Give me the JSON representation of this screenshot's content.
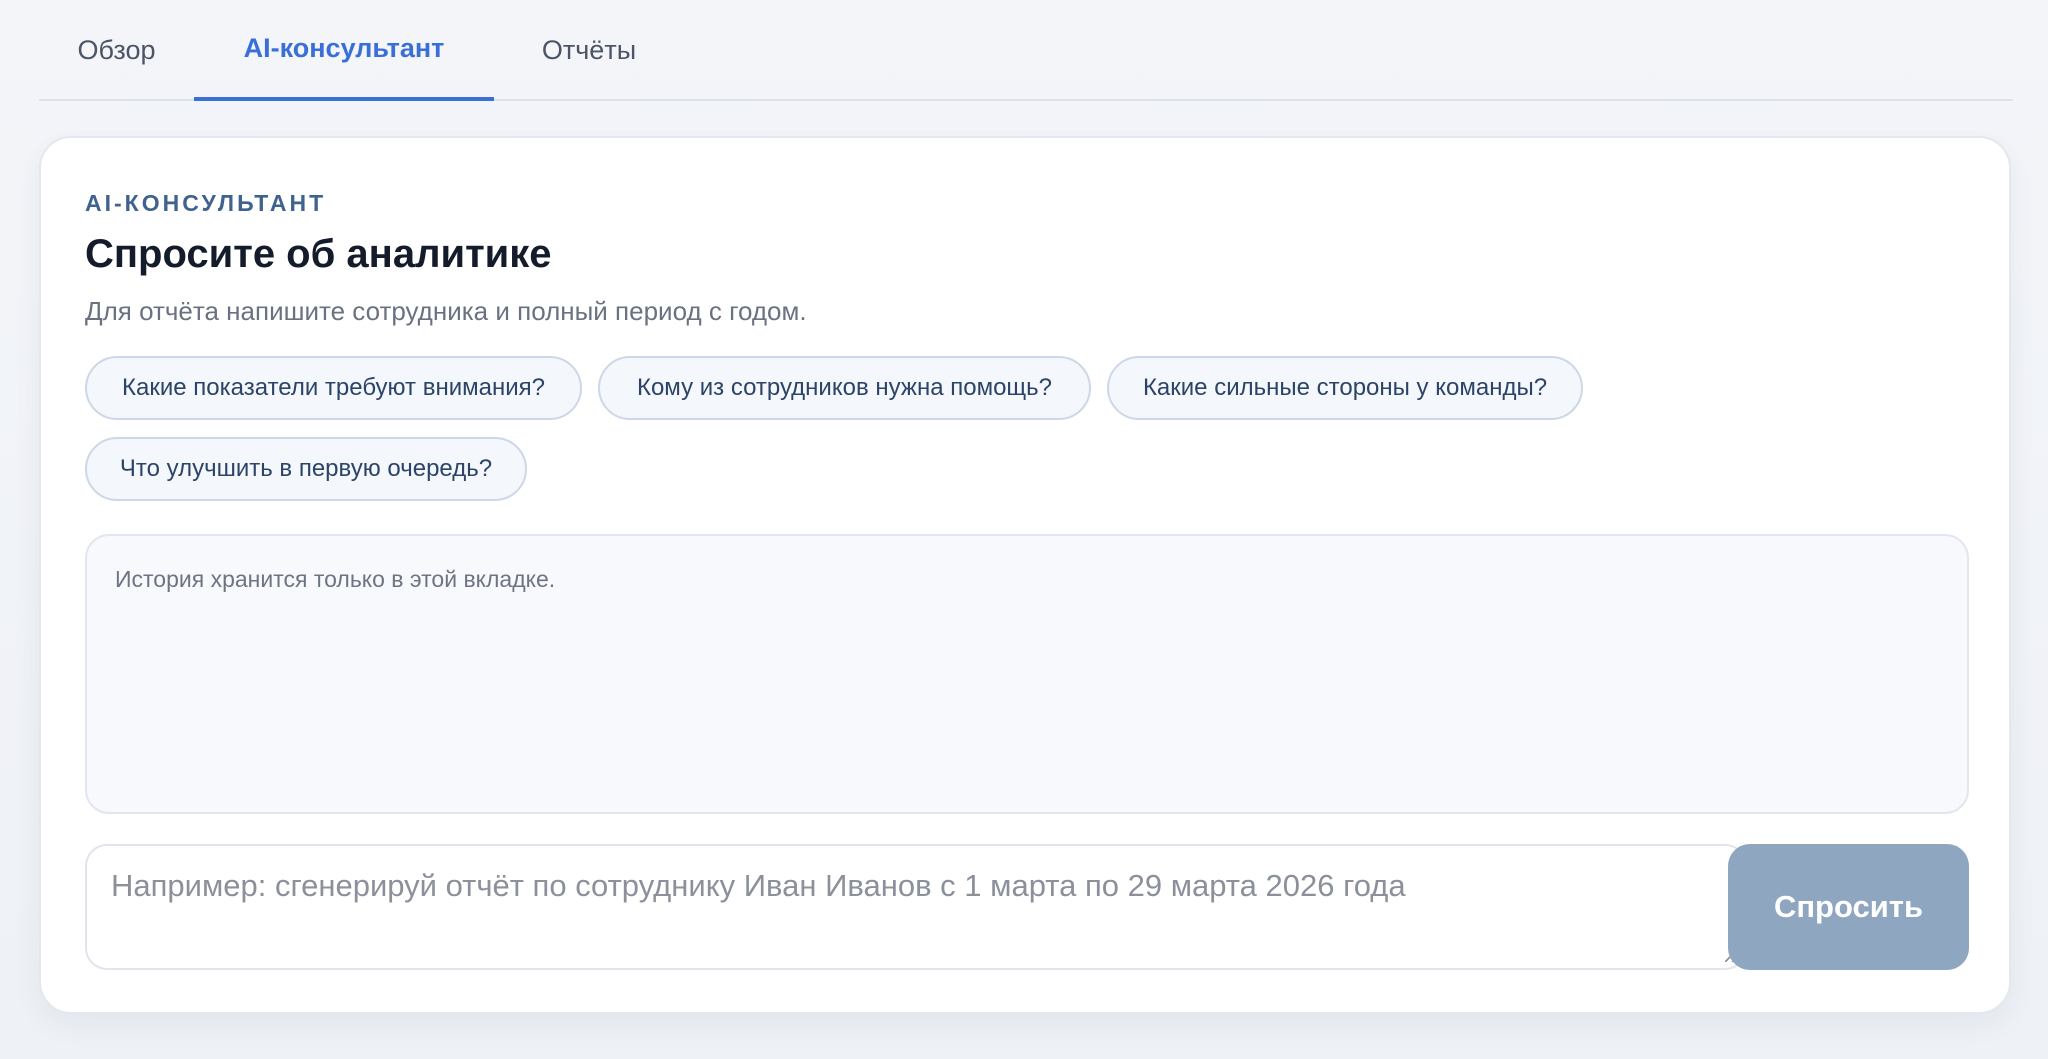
{
  "tabs": [
    {
      "label": "Обзор",
      "active": false
    },
    {
      "label": "AI-консультант",
      "active": true
    },
    {
      "label": "Отчёты",
      "active": false
    }
  ],
  "panel": {
    "eyebrow": "AI-КОНСУЛЬТАНТ",
    "title": "Спросите об аналитике",
    "subtitle": "Для отчёта напишите сотрудника и полный период с годом."
  },
  "suggestions": [
    "Какие показатели требуют внимания?",
    "Кому из сотрудников нужна помощь?",
    "Какие сильные стороны у команды?",
    "Что улучшить в первую очередь?"
  ],
  "history": {
    "empty_text": "История хранится только в этой вкладке."
  },
  "composer": {
    "value": "",
    "placeholder": "Например: сгенерируй отчёт по сотруднику Иван Иванов с 1 марта по 29 марта 2026 года",
    "submit_label": "Спросить"
  },
  "colors": {
    "accent": "#3b6fd8",
    "button_disabled": "#8fa6c1",
    "chip_border": "#cdd7e6",
    "chip_background": "#f4f7fc"
  }
}
